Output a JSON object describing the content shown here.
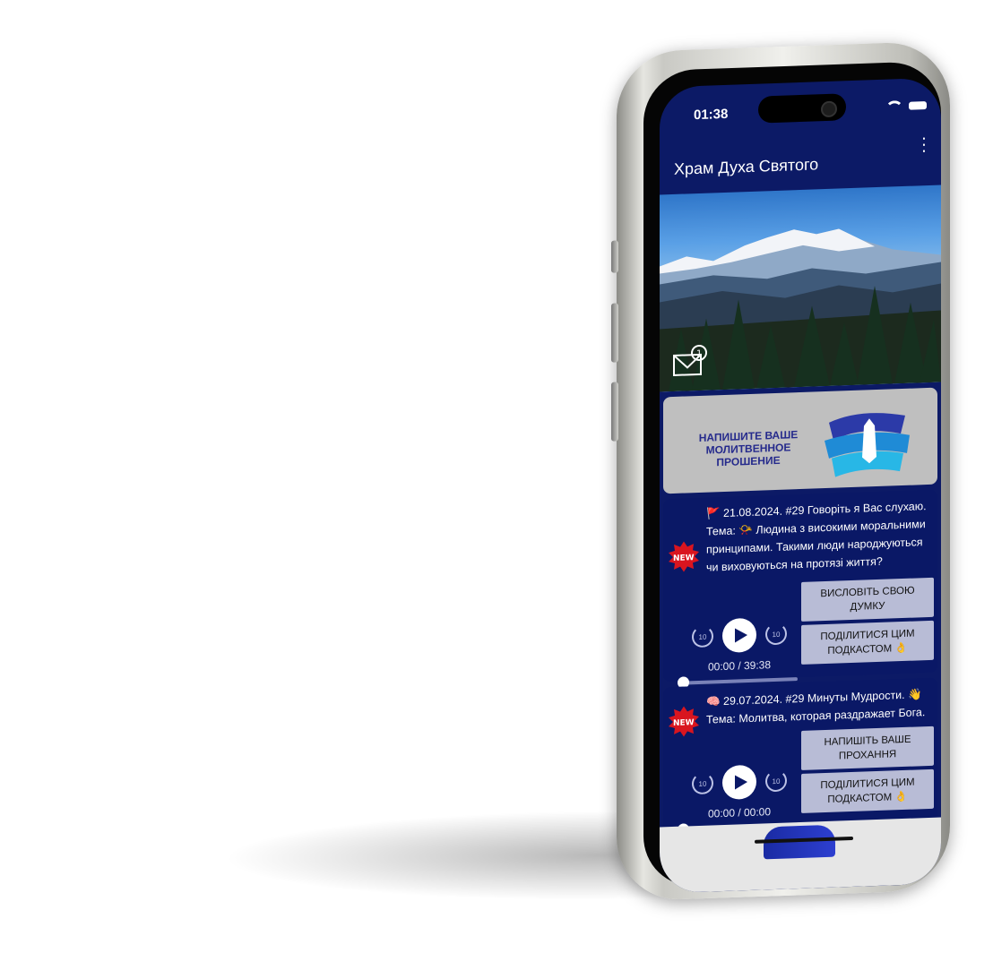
{
  "status_bar": {
    "time": "01:38"
  },
  "app_bar": {
    "title": "Храм Духа Святого",
    "menu_icon": "more-vert-icon"
  },
  "hero": {
    "mail_icon": "mail-notification-icon",
    "mail_badge": "1"
  },
  "prayer_banner": {
    "text": "НАПИШИТЕ ВАШЕ МОЛИТВЕННОЕ ПРОШЕНИЕ"
  },
  "podcasts": [
    {
      "badge": "NEW",
      "text": "🚩 21.08.2024. #29 Говоріть я Вас слухаю. Тема: 📯 Людина з високими моральними принципами. Такими люди народжуються чи виховуються на протязі життя?",
      "time": "00:00 / 39:38",
      "progress": 0,
      "button1": "ВИСЛОВІТЬ СВОЮ ДУМКУ",
      "button2": "ПОДІЛИТИСЯ ЦИМ ПОДКАСТОМ 👌"
    },
    {
      "badge": "NEW",
      "text": "🧠 29.07.2024. #29 Минуты Мудрости. 👋 Тема: Молитва, которая раздражает Бога.",
      "time": "00:00 / 00:00",
      "progress": 0,
      "button1": "НАПИШІТЬ ВАШЕ ПРОХАННЯ",
      "button2": "ПОДІЛИТИСЯ ЦИМ ПОДКАСТОМ 👌"
    }
  ],
  "colors": {
    "primary": "#0c1a66",
    "button_bg": "#b8bcd6",
    "banner_bg": "#bfbfbf",
    "new_badge": "#d9151f"
  }
}
